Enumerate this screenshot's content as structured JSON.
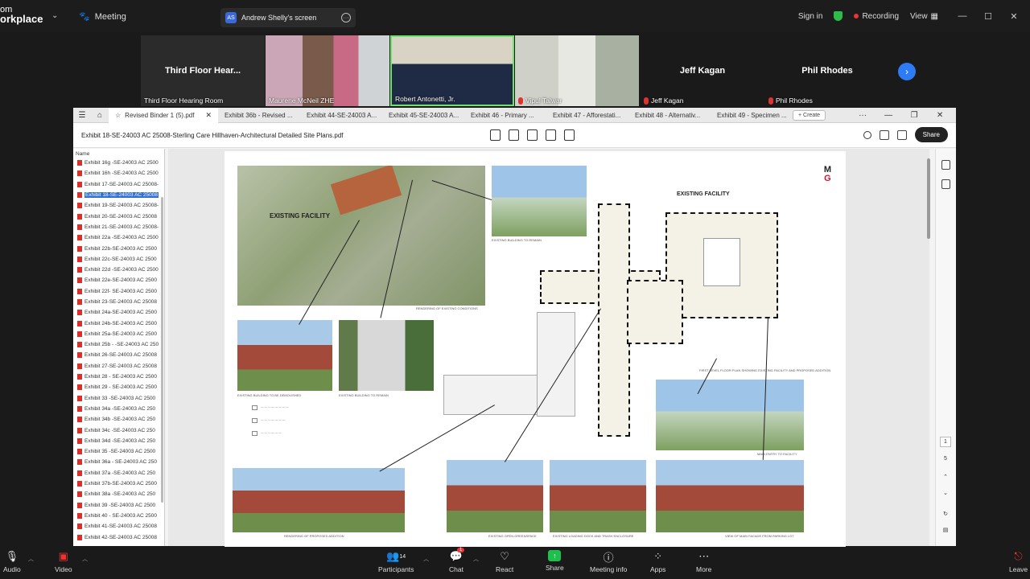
{
  "app": {
    "brand_line1": "om",
    "brand_line2": "orkplace",
    "meeting_label": "Meeting",
    "screen_tab": {
      "initials": "AS",
      "label": "Andrew Shelly's screen"
    },
    "sign_in": "Sign in",
    "recording": "Recording",
    "view": "View"
  },
  "gallery": {
    "tiles": [
      {
        "name": "Third Floor Hear...",
        "caption": "Third Floor Hearing Room",
        "muted": false
      },
      {
        "name": "",
        "caption": "Maurene McNeil ZHE",
        "muted": false
      },
      {
        "name": "",
        "caption": "Robert Antonetti, Jr.",
        "muted": false
      },
      {
        "name": "",
        "caption": "Vipul Talwar",
        "muted": true
      },
      {
        "name": "Jeff Kagan",
        "caption": "Jeff Kagan",
        "muted": true
      },
      {
        "name": "Phil Rhodes",
        "caption": "Phil Rhodes",
        "muted": true
      }
    ]
  },
  "viewer": {
    "tabs": [
      "Revised Binder 1 (5).pdf",
      "Exhibit 36b - Revised ...",
      "Exhibit 44-SE-24003 A...",
      "Exhibit 45-SE-24003 A...",
      "Exhibit 46 - Primary ...",
      "Exhibit 47 - Afforestati...",
      "Exhibit 48 - Alternativ...",
      "Exhibit 49 - Specimen ..."
    ],
    "create_label": "Create",
    "doc_title": "Exhibit 18-SE-24003 AC 25008-Sterling Care Hillhaven-Architectural Detailed Site Plans.pdf",
    "share_label": "Share",
    "sidebar_header": "Name",
    "files": [
      "Exhibit 16g -SE-24003 AC 2500",
      "Exhibit 16h -SE-24003 AC 2500",
      "Exhibit 17-SE-24003 AC 25008-",
      "Exhibit 18-SE-24003 AC 25008",
      "Exhibit 19-SE-24003 AC 25008-",
      "Exhibit 20-SE-24003 AC 25008",
      "Exhibit 21-SE-24003 AC 25008-",
      "Exhibit 22a -SE-24003 AC 2500",
      "Exhibit 22b-SE-24003 AC 2500",
      "Exhibit 22c-SE-24003 AC 2500",
      "Exhibit 22d -SE-24003 AC 2500",
      "Exhibit 22e-SE-24003 AC 2500",
      "Exhibit 22f- SE-24003 AC 2500",
      "Exhibit 23-SE-24003 AC 25008",
      "Exhibit 24a-SE-24003 AC 2500",
      "Exhibit 24b-SE-24003 AC 2500",
      "Exhibit 25a-SE-24003 AC 2500",
      "Exhibit 25b - -SE-24003 AC 250",
      "Exhibit 26-SE-24003 AC 25008",
      "Exhibit 27-SE-24003 AC 25008",
      "Exhibit 28 - SE-24003 AC 2500",
      "Exhibit 29 - SE-24003 AC 2500",
      "Exhibit 33 -SE-24003 AC 2500",
      "Exhibit 34a -SE-24003 AC 250",
      "Exhibit 34b -SE-24003 AC 250",
      "Exhibit 34c -SE-24003 AC 250",
      "Exhibit 34d -SE-24003 AC 250",
      "Exhibit 35 -SE-24003 AC 2500",
      "Exhibit 36a - SE-24003 AC 250",
      "Exhibit 37a -SE-24003 AC 250",
      "Exhibit 37b-SE-24003 AC 2500",
      "Exhibit 38a -SE-24003 AC 250",
      "Exhibit 39 -SE-24003 AC 2500",
      "Exhibit 40 - SE-24003 AC 2500",
      "Exhibit 41-SE-24003 AC 25008",
      "Exhibit 42-SE-24003 AC 25008"
    ],
    "selected_index": 3,
    "page": {
      "logo_top": "M",
      "logo_bottom": "G",
      "existing_facility_label": "EXISTING FACILITY",
      "aerial_label": "EXISTING FACILITY",
      "captions": {
        "aerial": "RENDERING OF EXISTING CONDITIONS",
        "remain_top": "EXISTING BUILDING TO REMAIN",
        "demolish": "EXISTING BUILDING TO BE DEMOLISHED",
        "remain_mid": "EXISTING BUILDING TO REMAIN",
        "rendering_proposed": "RENDERING OF PROPOSED ADDITION",
        "open_greenspace": "EXISTING OPEN GREENSPACE",
        "loading_dock": "EXISTING LOADING DOCK AND TRASH ENCLOSURE",
        "main_facade": "VIEW OF MAIN FACADE FROM PARKING LOT",
        "main_entry": "MAIN ENTRY TO FACILITY",
        "floor_plan": "FIRST LEVEL FLOOR PLAN SHOWING EXISTING FACILITY AND PROPOSED ADDITION"
      }
    },
    "pager": {
      "current": "1",
      "total": "5"
    }
  },
  "bottom": {
    "audio": "Audio",
    "video": "Video",
    "participants": "Participants",
    "participants_count": "14",
    "chat": "Chat",
    "chat_badge": "1",
    "react": "React",
    "share": "Share",
    "meeting_info": "Meeting info",
    "apps": "Apps",
    "more": "More",
    "leave": "Leave"
  }
}
